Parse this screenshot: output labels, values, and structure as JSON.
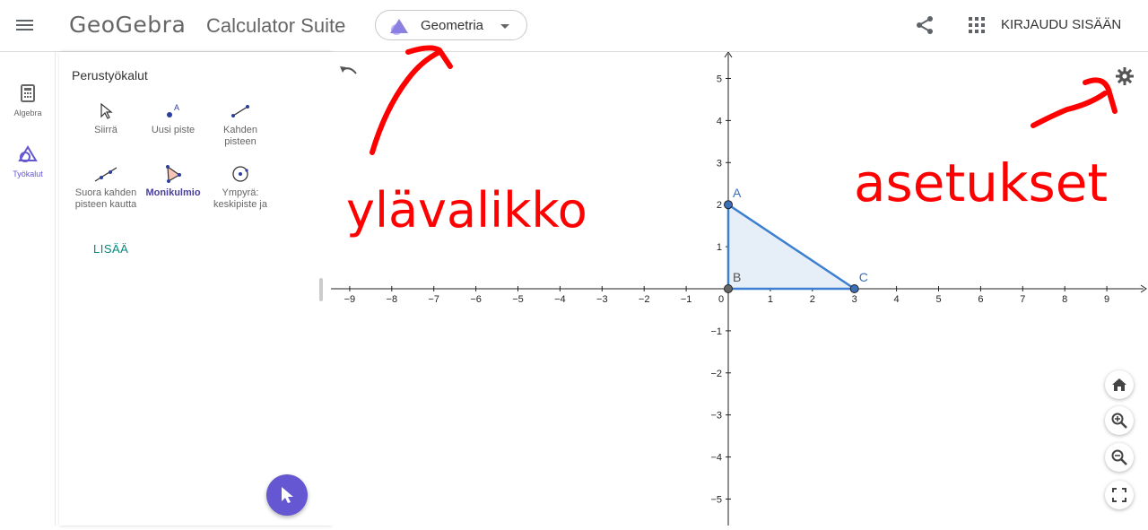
{
  "header": {
    "logo": "GeoGebra",
    "suite_title": "Calculator Suite",
    "app_picker": {
      "selected": "Geometria",
      "icon": "geometry-triangle-icon"
    },
    "login_label": "KIRJAUDU SISÄÄN"
  },
  "rail": {
    "items": [
      {
        "label": "Algebra",
        "icon": "calculator-icon",
        "active": false
      },
      {
        "label": "Työkalut",
        "icon": "tools-icon",
        "active": true
      }
    ]
  },
  "tools_panel": {
    "title": "Perustyökalut",
    "tools": [
      {
        "label": "Siirrä",
        "icon": "move-arrow-icon"
      },
      {
        "label": "Uusi piste",
        "icon": "point-icon"
      },
      {
        "label": "Kahden pisteen",
        "icon": "segment-icon"
      },
      {
        "label": "Suora kahden pisteen kautta",
        "icon": "line-icon"
      },
      {
        "label": "Monikulmio",
        "icon": "polygon-icon",
        "selected": true
      },
      {
        "label": "Ympyrä: keskipiste ja",
        "icon": "circle-icon"
      }
    ],
    "more_label": "LISÄÄ"
  },
  "graphics": {
    "x_ticks": [
      "−9",
      "−8",
      "−7",
      "−6",
      "−5",
      "−4",
      "−3",
      "−2",
      "−1",
      "0",
      "1",
      "2",
      "3",
      "4",
      "5",
      "6",
      "7",
      "8",
      "9"
    ],
    "y_ticks_pos": [
      "1",
      "2",
      "3",
      "4",
      "5"
    ],
    "y_ticks_neg": [
      "−1",
      "−2",
      "−3",
      "−4",
      "−5"
    ],
    "points": [
      {
        "name": "A",
        "x": 0,
        "y": 2
      },
      {
        "name": "B",
        "x": 0,
        "y": 0
      },
      {
        "name": "C",
        "x": 3,
        "y": 0
      }
    ],
    "polygon_color": "#3d7fd1",
    "fill_color": "#e6eef8"
  },
  "annotations": {
    "top_menu": "ylävalikko",
    "settings": "asetukset",
    "color": "#ff0000"
  },
  "colors": {
    "accent": "#6557d2",
    "more_link": "#00897b"
  }
}
